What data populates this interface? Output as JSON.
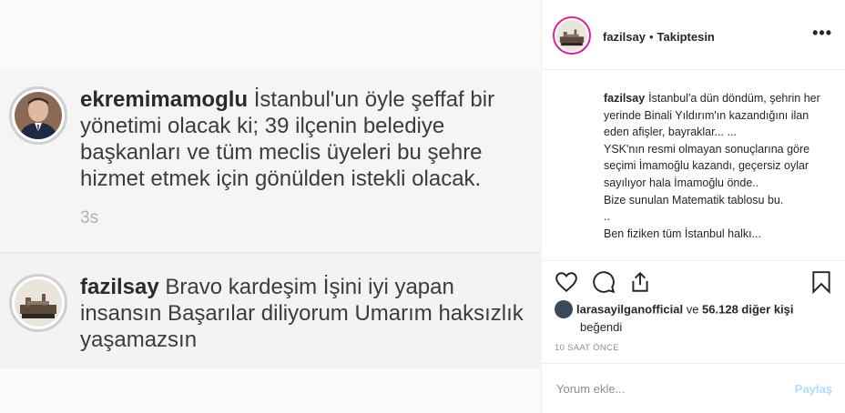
{
  "post_image": {
    "comments": [
      {
        "username": "ekremimamoglu",
        "text": "İstanbul'un öyle şeffaf bir yönetimi olacak ki; 39 ilçenin belediye başkanları ve tüm meclis üyeleri bu şehre hizmet etmek için gönülden istekli olacak.",
        "time": "3s"
      },
      {
        "username": "fazilsay",
        "text": "Bravo kardeşim  İşini iyi yapan insansın  Başarılar diliyorum  Umarım haksızlık yaşamazsın"
      }
    ]
  },
  "header": {
    "username": "fazilsay",
    "separator": "•",
    "follow_status": "Takiptesin",
    "more_icon": "•••"
  },
  "caption": {
    "username": "fazilsay",
    "lines": [
      "İstanbul'a dün döndüm, şehrin her yerinde Binali Yıldırım'ın kazandığını ilan eden afişler, bayraklar... ...",
      "YSK'nın resmi olmayan sonuçlarına göre seçimi İmamoğlu kazandı, geçersiz oylar sayılıyor hala İmamoğlu önde..",
      "Bize sunulan Matematik tablosu bu.",
      "..",
      "Ben fiziken tüm İstanbul halkı..."
    ]
  },
  "actions": {
    "icons": [
      "heart-icon",
      "comment-icon",
      "share-icon",
      "bookmark-icon"
    ]
  },
  "likes": {
    "liker": "larasayilganofficial",
    "connector": "ve",
    "count_text": "56.128 diğer kişi",
    "suffix": "beğendi"
  },
  "time_ago": "10 SAAT ÖNCE",
  "comment_input": {
    "placeholder": "Yorum ekle...",
    "post_label": "Paylaş"
  },
  "colors": {
    "link_blue": "#b3dbff",
    "story_ring": "#d6249f",
    "muted": "#8e8e8e"
  }
}
